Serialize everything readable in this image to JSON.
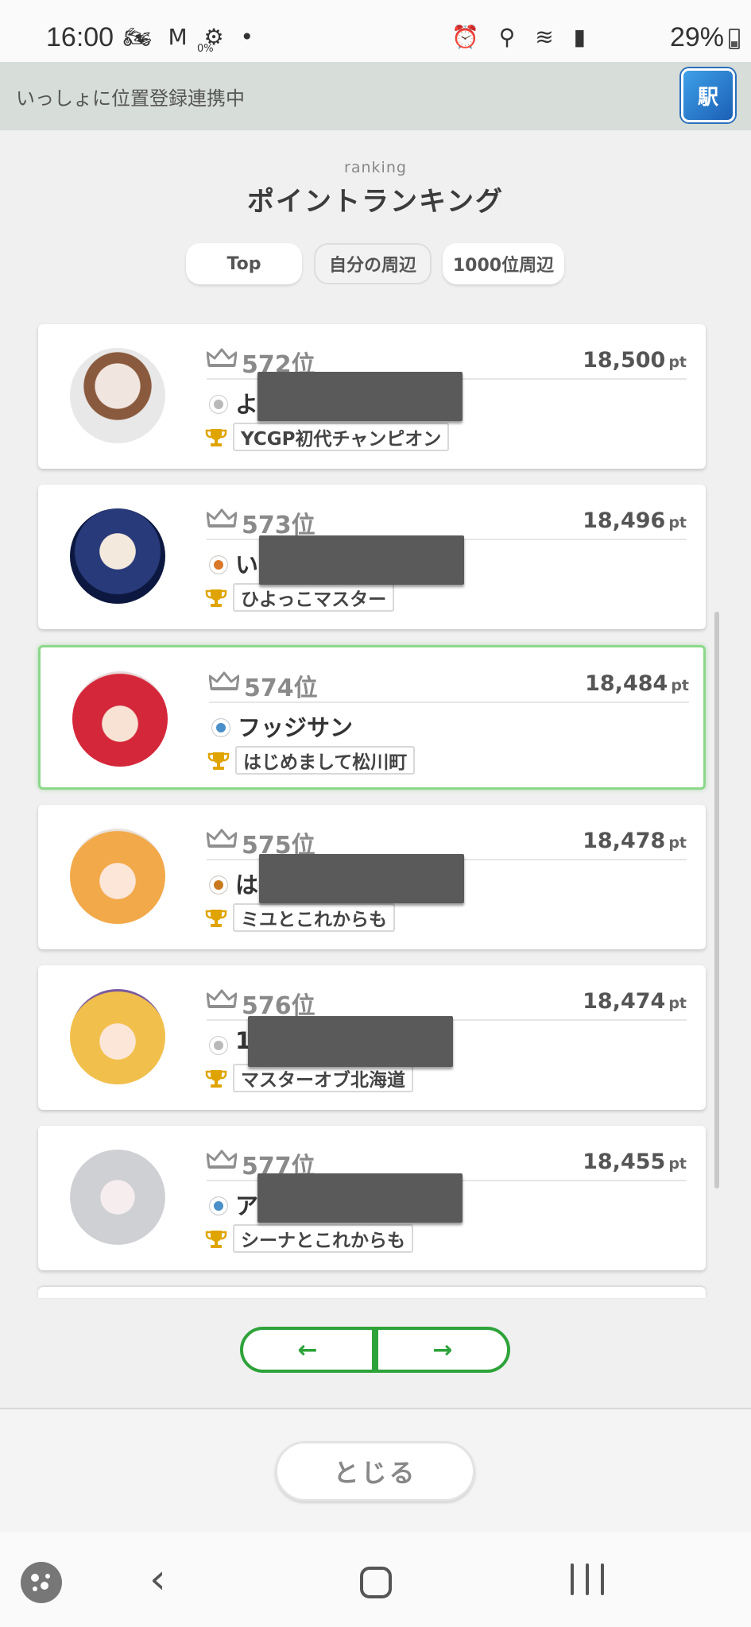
{
  "status_bar": {
    "time": "16:00",
    "left_icons": [
      "motorbike-icon",
      "gmail-icon",
      "data-saver-icon",
      "dot-icon"
    ],
    "left_icons_glyph": "🏍 M ⚙ •",
    "data_saver_text": "0%",
    "right_icons": [
      "alarm-icon",
      "location-icon",
      "wifi-icon",
      "signal-icon"
    ],
    "right_icons_glyph": "⏰ ⚲ ≋ ▮",
    "battery": "29%"
  },
  "banner": {
    "text": "いっしょに位置登録連携中",
    "app_icon_label": "駅"
  },
  "heading": {
    "sub": "ranking",
    "title": "ポイントランキング"
  },
  "tabs": [
    {
      "label": "Top"
    },
    {
      "label": "自分の周辺"
    },
    {
      "label": "1000位周辺"
    }
  ],
  "ranking": [
    {
      "rank": "572位",
      "points": "18,500",
      "unit": "pt",
      "name": "よ",
      "title": "YCGP初代チャンピオン",
      "badge_color": "#b9b9b9"
    },
    {
      "rank": "573位",
      "points": "18,496",
      "unit": "pt",
      "name": "い",
      "title": "ひよっこマスター",
      "badge_color": "#d9772a"
    },
    {
      "rank": "574位",
      "points": "18,484",
      "unit": "pt",
      "name": "フッジサン",
      "title": "はじめまして松川町",
      "badge_color": "#4a8fc9"
    },
    {
      "rank": "575位",
      "points": "18,478",
      "unit": "pt",
      "name": "は",
      "title": "ミユとこれからも",
      "badge_color": "#c9791e"
    },
    {
      "rank": "576位",
      "points": "18,474",
      "unit": "pt",
      "name": "1",
      "title": "マスターオブ北海道",
      "badge_color": "#b9b9b9"
    },
    {
      "rank": "577位",
      "points": "18,455",
      "unit": "pt",
      "name": "ア",
      "title": "シーナとこれからも",
      "badge_color": "#4a8fc9"
    }
  ],
  "pager": {
    "prev": "←",
    "next": "→"
  },
  "footer": {
    "close_label": "とじる"
  },
  "nav_bar": {
    "back": "‹"
  }
}
